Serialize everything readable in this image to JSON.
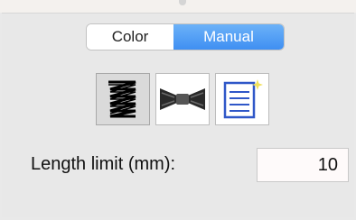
{
  "mode_switch": {
    "options": [
      "Color",
      "Manual"
    ],
    "selected": "Manual"
  },
  "stitch_buttons": [
    {
      "icon": "zigzag-stitch-icon",
      "selected": true
    },
    {
      "icon": "bowtie-stitch-icon",
      "selected": false
    },
    {
      "icon": "list-pattern-icon",
      "selected": false
    }
  ],
  "length_limit": {
    "label": "Length limit (mm):",
    "value": "10"
  },
  "colors": {
    "selected_segment": "#3f8ff2",
    "panel_bg": "#e8e8e8"
  }
}
